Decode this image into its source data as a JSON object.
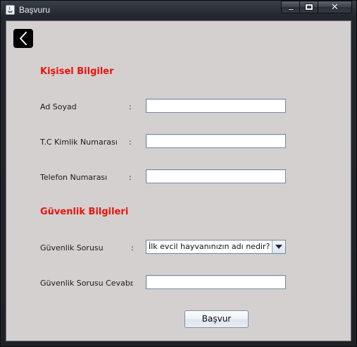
{
  "window": {
    "title": "Başvuru",
    "minimize_icon": "minimize-icon",
    "maximize_icon": "maximize-icon",
    "close_icon": "close-icon",
    "close_glyph": "✕"
  },
  "back_button": {
    "icon": "back-arrow-icon"
  },
  "personal": {
    "title": "Kişisel Bilgiler",
    "fields": [
      {
        "label": "Ad Soyad",
        "colon": ":",
        "value": ""
      },
      {
        "label": "T.C Kimlik Numarası",
        "colon": ":",
        "value": ""
      },
      {
        "label": "Telefon Numarası",
        "colon": ":",
        "value": ""
      }
    ]
  },
  "security": {
    "title": "Güvenlik Bilgileri",
    "question_label": "Güvenlik Sorusu",
    "question_colon": ":",
    "question_selected": "İlk evcil hayvanınızın adı nedir?",
    "answer_label": "Güvenlik Sorusu Cevabı",
    "answer_colon": ":",
    "answer_value": ""
  },
  "submit_label": "Başvur",
  "colors": {
    "section_title": "#e8140c",
    "background": "#d4d0d0"
  }
}
